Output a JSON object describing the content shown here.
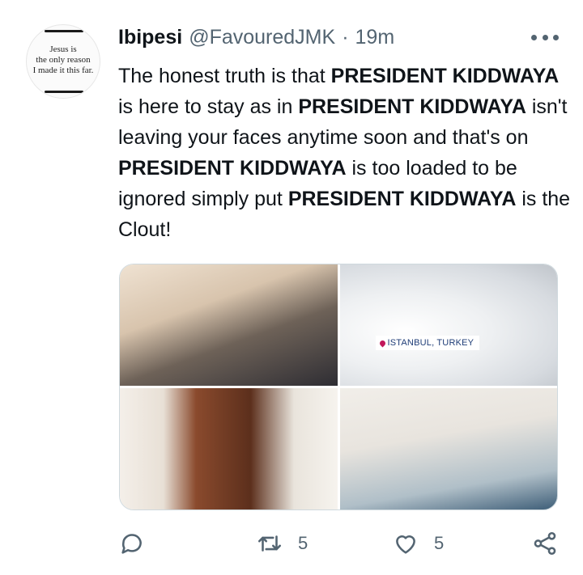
{
  "author": {
    "display_name": "Ibipesi",
    "handle": "@FavouredJMK",
    "separator": "·",
    "time": "19m",
    "avatar_text": [
      "Jesus is",
      "the only reason",
      "I made it this far."
    ]
  },
  "tweet": {
    "segments": [
      {
        "text": "The honest truth is that ",
        "bold": false
      },
      {
        "text": "PRESIDENT KIDDWAYA",
        "bold": true
      },
      {
        "text": " is here to stay as in ",
        "bold": false
      },
      {
        "text": "PRESIDENT KIDDWAYA",
        "bold": true
      },
      {
        "text": " isn't leaving your faces anytime soon and that's on ",
        "bold": false
      },
      {
        "text": "PRESIDENT KIDDWAYA",
        "bold": true
      },
      {
        "text": " is too loaded to be ignored simply put ",
        "bold": false
      },
      {
        "text": "PRESIDENT KIDDWAYA",
        "bold": true
      },
      {
        "text": " is the Clout!",
        "bold": false
      }
    ]
  },
  "media": {
    "location_badge": "ISTANBUL, TURKEY"
  },
  "actions": {
    "reply_icon": "reply-icon",
    "retweet_icon": "retweet-icon",
    "retweet_count": "5",
    "like_icon": "heart-icon",
    "like_count": "5",
    "share_icon": "share-icon"
  },
  "colors": {
    "text": "#0f1419",
    "muted": "#536471",
    "border": "#cfd9de"
  }
}
